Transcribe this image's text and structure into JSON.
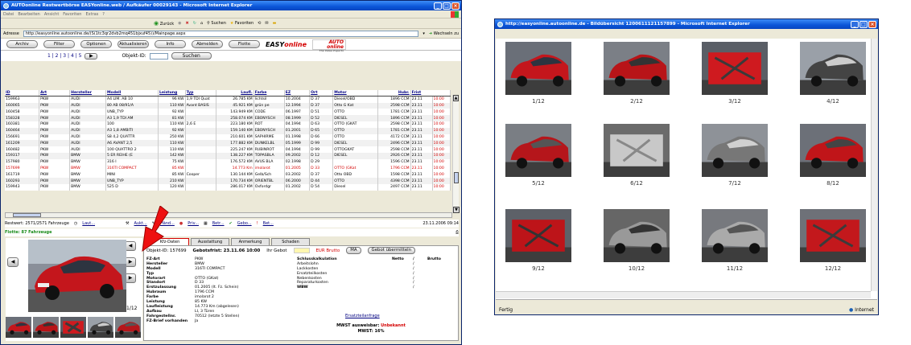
{
  "win1": {
    "title": "AUTOonline Restwertbörse EASYonline.web / Aufkäufer 00029143 - Microsoft Internet Explorer",
    "menu": [
      "Datei",
      "Bearbeiten",
      "Ansicht",
      "Favoriten",
      "Extras",
      "?"
    ],
    "toolbar": {
      "back": "Zurück",
      "search": "Suchen",
      "favorites": "Favoriten"
    },
    "address": {
      "label": "Adresse",
      "url": "http://easyonline.autoonline.de/(S(1tc3qr2dvb2mq451bjxuf45))/Mainpage.aspx",
      "go": "Wechseln zu"
    },
    "nav": [
      "Archiv",
      "Filter",
      "Optionen",
      "Aktualisieren",
      "Info",
      "Abmelden",
      "Flotte"
    ],
    "logo": {
      "easy": "EASY",
      "online": "online",
      "auto1": "AUTO",
      "auto2": "online",
      "tagline": "The Value Experts"
    },
    "pager": {
      "pages": "1 | 2 | 3 | 4 | 5",
      "objekt_label": "Objekt-ID:",
      "search_button": "Suchen"
    },
    "columns": [
      "ID",
      "Art",
      "Hersteller",
      "Modell",
      "Leistung",
      "Typ",
      "Laufl.",
      "Farbe",
      "EZ",
      "Ort",
      "Motor",
      "Hubr.",
      "Frist"
    ],
    "rows": [
      [
        "159963",
        "PKW",
        "AUDI",
        "A4 LIM. AB 10",
        "96 KW",
        "1,9 TDI Quat",
        "26.785 KM",
        "lichtsil",
        "10.2004",
        "D 37",
        "Diesel/OBD",
        "1896 CCM",
        "23.11",
        "10:00"
      ],
      [
        "160065",
        "PKW",
        "AUDI",
        "80 AB 08/91/A",
        "110 KW",
        "Avant BASIS",
        "45.921 KM",
        "grün pe",
        "12.1994",
        "D 37",
        "Otto G Kat",
        "2598 CCM",
        "23.11",
        "10:00"
      ],
      [
        "160458",
        "PKW",
        "AUDI",
        "UNB_TYP",
        "92 KW",
        "",
        "143.949 KM",
        "CODE",
        "06.1997",
        "D 51",
        "OTTO",
        "1781 CCM",
        "23.11",
        "10:00"
      ],
      [
        "158328",
        "PKW",
        "AUDI",
        "A3 1,9 TDI AM",
        "81 KW",
        "",
        "258.074 KM",
        "EBONYSCH",
        "08.1999",
        "D 52",
        "DIESEL",
        "1896 CCM",
        "23.11",
        "10:00"
      ],
      [
        "160381",
        "PKW",
        "AUDI",
        "100",
        "110 KW",
        "2,6 E",
        "223.180 KM",
        "ROT",
        "04.1994",
        "D 63",
        "OTTO (GKAT",
        "2598 CCM",
        "23.11",
        "10:00"
      ],
      [
        "160464",
        "PKW",
        "AUDI",
        "A3 1,8 AMBITI",
        "92 KW",
        "",
        "159.140 KM",
        "EBONYSCH",
        "01.2001",
        "D 65",
        "OTTO",
        "1781 CCM",
        "23.11",
        "10:00"
      ],
      [
        "156691",
        "PKW",
        "AUDI",
        "S8 4,2 QUATTR",
        "250 KW",
        "",
        "210.601 KM",
        "SAPHIRME",
        "01.1998",
        "D 66",
        "OTTO",
        "4172 CCM",
        "23.11",
        "10:00"
      ],
      [
        "161209",
        "PKW",
        "AUDI",
        "A6 AVANT 2,5",
        "110 KW",
        "",
        "177.882 KM",
        "DUNKELBL",
        "05.1999",
        "D 99",
        "DIESEL",
        "2496 CCM",
        "23.11",
        "10:00"
      ],
      [
        "160482",
        "PKW",
        "AUDI",
        "100 QUATTRO 2",
        "110 KW",
        "",
        "225.247 KM",
        "RUBINROT",
        "04.1994",
        "D 99",
        "OTTOGKAT",
        "2598 CCM",
        "23.11",
        "10:00"
      ],
      [
        "159317",
        "PKW",
        "BMW",
        "5 ER REIHE (E",
        "142 KW",
        "",
        "138.227 KM",
        "TOPASBLA",
        "09.2002",
        "D 12",
        "DIESEL",
        "2926 CCM",
        "23.11",
        "10:00"
      ],
      [
        "157980",
        "PKW",
        "BMW",
        "316 I",
        "75 KW",
        "",
        "176.572 KM",
        "AVUS BLA",
        "02.1998",
        "D 29",
        "",
        "1596 CCM",
        "23.11",
        "10:00"
      ],
      [
        "157699",
        "PKW",
        "BMW",
        "316TI COMPACT",
        "85 KW",
        "",
        "14.773 Km",
        "imolarot",
        "01.2005",
        "D 33",
        "OTTO (GKat",
        "1796 CCM",
        "23.11",
        "10:00"
      ],
      [
        "161719",
        "PKW",
        "BMW",
        "MINI",
        "85 KW",
        "Cooper",
        "130.144 KM",
        "Gelb/Sch",
        "03.2002",
        "D 37",
        "Otto OBD",
        "1598 CCM",
        "23.11",
        "10:00"
      ],
      [
        "160293",
        "PKW",
        "BMW",
        "UNB_TYP",
        "210 KW",
        "",
        "170.734 KM",
        "ORIENTBL",
        "06.2000",
        "D 44",
        "OTTO",
        "4398 CCM",
        "23.11",
        "10:00"
      ],
      [
        "159943",
        "PKW",
        "BMW",
        "525 D",
        "120 KW",
        "",
        "286.017 KM",
        "Oxfordgr",
        "01.2002",
        "D 54",
        "Diesel",
        "2497 CCM",
        "23.11",
        "10:00"
      ]
    ],
    "status": {
      "count": "Restwert: 2571/2571 Fahrzeuge",
      "links": [
        "Laut...",
        "Aukt...",
        "Händ...",
        "Priv...",
        "Betr...",
        "Gebo...",
        "Bet..."
      ],
      "datetime": "23.11.2006 09:14"
    },
    "flotte": "Flotte: 87 Fahrzeuge",
    "pic_counter": "1/12",
    "tabs": [
      "Kfz-Daten",
      "Ausstattung",
      "Anmerkung",
      "Schaden"
    ],
    "detail": {
      "objekt": "Objekt-ID: 157699",
      "frist": "Gebotsfrist: 23.11.06 10:00",
      "gebot_label": "Ihr Gebot",
      "eur": "EUR Brutto",
      "ma": "MA",
      "gebot_btn": "Gebot übermitteln",
      "fields": [
        [
          "FZ-Art",
          "PKW"
        ],
        [
          "Hersteller",
          "BMW"
        ],
        [
          "Modell",
          "316TI COMPACT"
        ],
        [
          "Typ",
          ""
        ],
        [
          "Motorart",
          "OTTO (GKat)"
        ],
        [
          "Standort",
          "D 33"
        ],
        [
          "Erstzulassung",
          "01.2005 (lt. Fz. Schein)"
        ],
        [
          "Hubraum",
          "1796 CCM"
        ],
        [
          "Farbe",
          "imolarot 2"
        ],
        [
          "Leistung",
          "85 KW"
        ],
        [
          "Laufleistung",
          "14.773 Km (abgelesen)"
        ],
        [
          "Aufbau",
          "LI, 3 Türen"
        ],
        [
          "Fahrgestellnr.",
          "70512 (letzte 5 Stellen)"
        ],
        [
          "FZ-Brief vorhanden",
          "Ja"
        ]
      ],
      "sk_header": [
        "Schlusskalkulation",
        "Netto",
        "Brutto"
      ],
      "sk_rows": [
        "Arbeitslohn",
        "Lackkosten",
        "Ersatzteilkosten",
        "Nebenkosten",
        "Reparaturkosten",
        "WBW"
      ],
      "sk_sep": "/",
      "ersatz": "Ersatzteilanfrage",
      "mwst_label": "MWST ausweisbar:",
      "mwst_value": "Unbekannt",
      "mwst_rate": "MWST: 16%"
    }
  },
  "win2": {
    "title": "http://easyonline.autoonline.de - Bildübersicht 1200611121157899 - Microsoft Internet Explorer",
    "captions": [
      "1/12",
      "2/12",
      "3/12",
      "4/12",
      "5/12",
      "6/12",
      "7/12",
      "8/12",
      "9/12",
      "10/12",
      "11/12",
      "12/12"
    ],
    "status_left": "Fertig",
    "status_right": "Internet"
  }
}
